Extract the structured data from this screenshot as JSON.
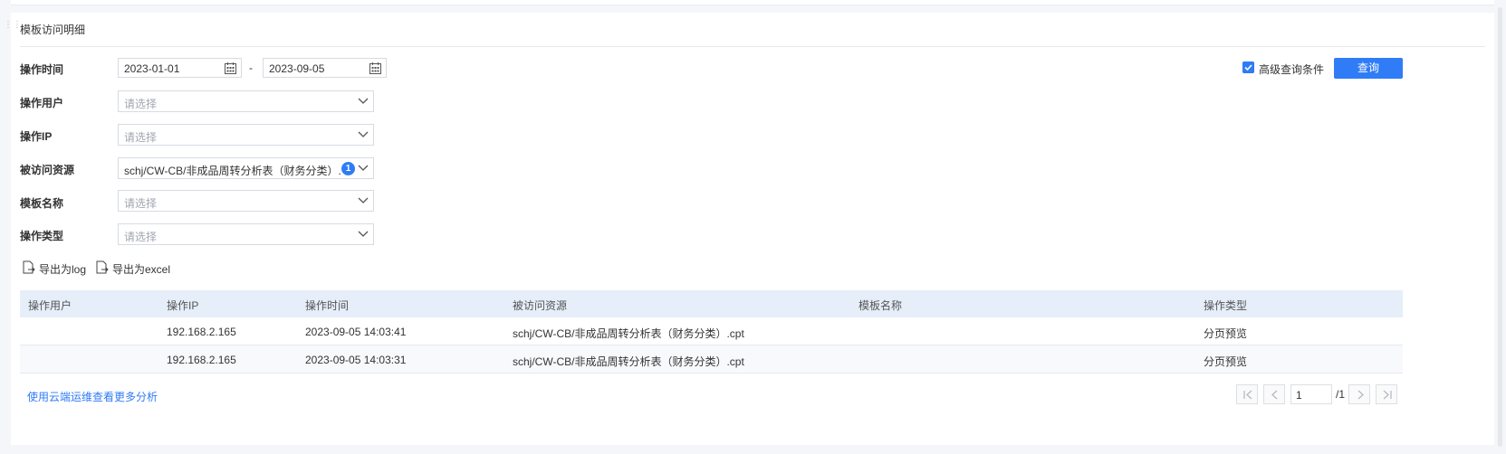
{
  "panel": {
    "title": "模板访问明细"
  },
  "form": {
    "time_label": "操作时间",
    "date_from": "2023-01-01",
    "date_separator": "-",
    "date_to": "2023-09-05",
    "user_label": "操作用户",
    "user_placeholder": "请选择",
    "ip_label": "操作IP",
    "ip_placeholder": "请选择",
    "resource_label": "被访问资源",
    "resource_value": "schj/CW-CB/非成品周转分析表（财务分类）.cpt",
    "resource_badge": "1",
    "template_label": "模板名称",
    "template_placeholder": "请选择",
    "type_label": "操作类型",
    "type_placeholder": "请选择",
    "advanced_label": "高级查询条件",
    "advanced_checked": true,
    "query_button": "查询"
  },
  "exports": {
    "log_label": "导出为log",
    "excel_label": "导出为excel"
  },
  "table": {
    "headers": [
      "操作用户",
      "操作IP",
      "操作时间",
      "被访问资源",
      "模板名称",
      "操作类型"
    ],
    "rows": [
      [
        "",
        "192.168.2.165",
        "2023-09-05 14:03:41",
        "schj/CW-CB/非成品周转分析表（财务分类）.cpt",
        "",
        "分页预览"
      ],
      [
        "",
        "192.168.2.165",
        "2023-09-05 14:03:31",
        "schj/CW-CB/非成品周转分析表（财务分类）.cpt",
        "",
        "分页预览"
      ]
    ]
  },
  "footer": {
    "more_link": "使用云端运维查看更多分析",
    "page_current": "1",
    "page_total": "/1"
  },
  "colors": {
    "accent": "#2f7cf6",
    "header_bg": "#e6eefa"
  },
  "icons": {
    "calendar": "calendar-icon",
    "chevron": "chevron-down-icon",
    "export": "export-file-icon",
    "pager": [
      "first-page-icon",
      "prev-page-icon",
      "next-page-icon",
      "last-page-icon"
    ]
  }
}
